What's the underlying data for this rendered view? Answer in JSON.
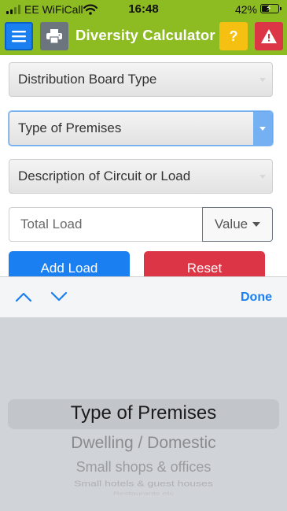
{
  "status_bar": {
    "carrier": "EE WiFiCall",
    "time": "16:48",
    "battery_percent": "42%",
    "battery_level": 0.42
  },
  "header": {
    "title": "Diversity Calculator",
    "menu_icon": "hamburger-menu-icon",
    "print_icon": "printer-icon",
    "help_label": "?",
    "warning_icon": "warning-triangle-icon",
    "colors": {
      "bar": "#8dbb22",
      "menu": "#1a7ff0",
      "print": "#6c757d",
      "help": "#f5c012",
      "warning": "#dc3545"
    }
  },
  "form": {
    "board_type_select": "Distribution Board Type",
    "premises_select": "Type of Premises",
    "circuit_select": "Description of Circuit or Load",
    "total_load_placeholder": "Total Load",
    "value_dropdown": "Value",
    "add_button": "Add Load",
    "reset_button": "Reset"
  },
  "picker": {
    "toolbar_up_icon": "chevron-up-icon",
    "toolbar_down_icon": "chevron-down-icon",
    "done_label": "Done",
    "options": [
      "Type of Premises",
      "Dwelling / Domestic",
      "Small shops & offices",
      "Small hotels & guest houses",
      "Restaurants etc"
    ],
    "selected_index": 0
  }
}
